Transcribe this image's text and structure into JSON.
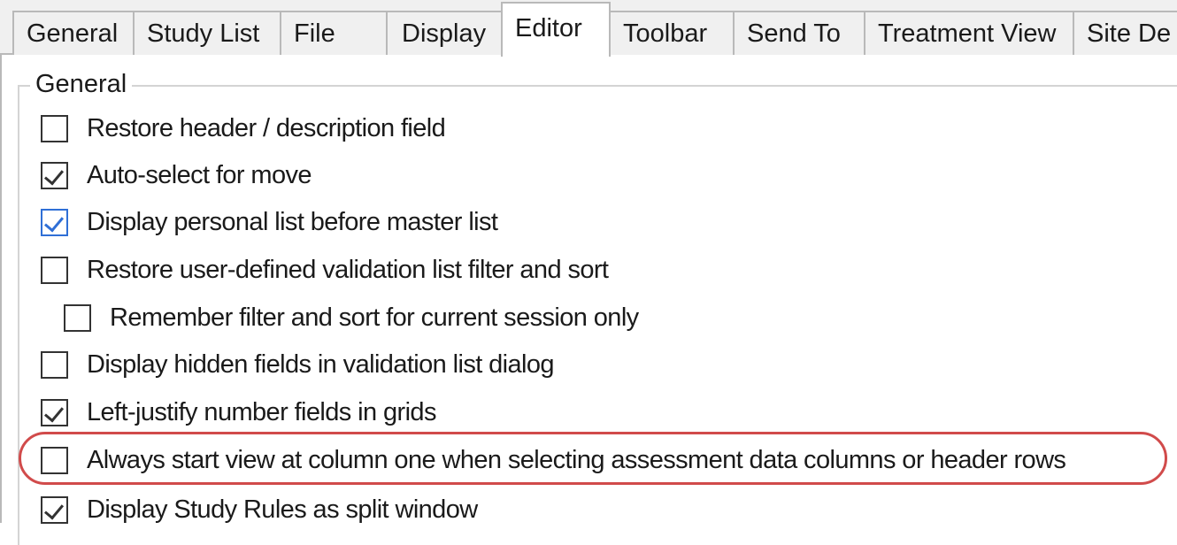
{
  "tabs": [
    {
      "label": "General",
      "active": false
    },
    {
      "label": "Study List",
      "active": false
    },
    {
      "label": "File",
      "active": false
    },
    {
      "label": "Display",
      "active": false
    },
    {
      "label": "Editor",
      "active": true
    },
    {
      "label": "Toolbar",
      "active": false
    },
    {
      "label": "Send To",
      "active": false
    },
    {
      "label": "Treatment View",
      "active": false
    },
    {
      "label": "Site De",
      "active": false
    }
  ],
  "group": {
    "title": "General",
    "options": [
      {
        "label": "Restore header / description field",
        "checked": false
      },
      {
        "label": "Auto-select for move",
        "checked": true
      },
      {
        "label": "Display personal list before master list",
        "checked": true,
        "focused": true
      },
      {
        "label": "Restore user-defined validation list filter and sort",
        "checked": false
      },
      {
        "label": "Remember filter and sort for current session only",
        "checked": false,
        "indented": true
      },
      {
        "label": "Display hidden fields in validation list dialog",
        "checked": false
      },
      {
        "label": "Left-justify number fields in grids",
        "checked": true
      },
      {
        "label": "Always start view at column one when selecting assessment data columns or header rows",
        "checked": false,
        "highlighted": true
      },
      {
        "label": "Display Study Rules as split window",
        "checked": true
      }
    ]
  },
  "colors": {
    "highlight": "#d14b4b",
    "focus_check": "#2f6fd6"
  }
}
